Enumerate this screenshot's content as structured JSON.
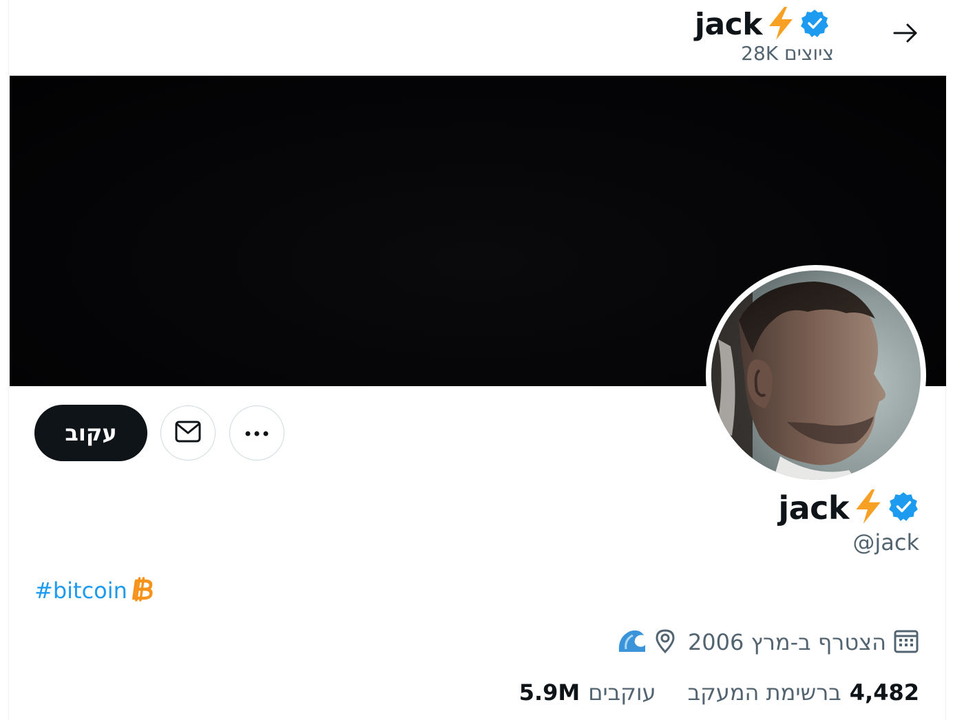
{
  "header": {
    "name": "jack",
    "post_count_label": "ציוצים 28K"
  },
  "profile": {
    "display_name": "jack",
    "handle": "@jack",
    "bio_hashtag": "#bitcoin",
    "joined": "הצטרף ב-מרץ 2006"
  },
  "actions": {
    "follow_label": "עקוב"
  },
  "stats": {
    "following_count": "4,482",
    "following_label": "ברשימת המעקב",
    "followers_count": "5.9M",
    "followers_label": "עוקבים"
  },
  "icons": {
    "back": "arrow-right-icon",
    "verified": "verified-badge-icon",
    "lightning": "lightning-emoji-icon",
    "bitcoin": "bitcoin-icon",
    "message": "envelope-icon",
    "more": "more-dots-icon",
    "location": "location-pin-icon",
    "wave": "wave-emoji-icon",
    "calendar": "calendar-icon"
  },
  "colors": {
    "verified_blue": "#1d9bf0",
    "lightning_orange": "#f7a024",
    "bitcoin_orange": "#f7931a",
    "link_blue": "#1d9bf0",
    "text_primary": "#0f1419",
    "text_secondary": "#536471"
  }
}
